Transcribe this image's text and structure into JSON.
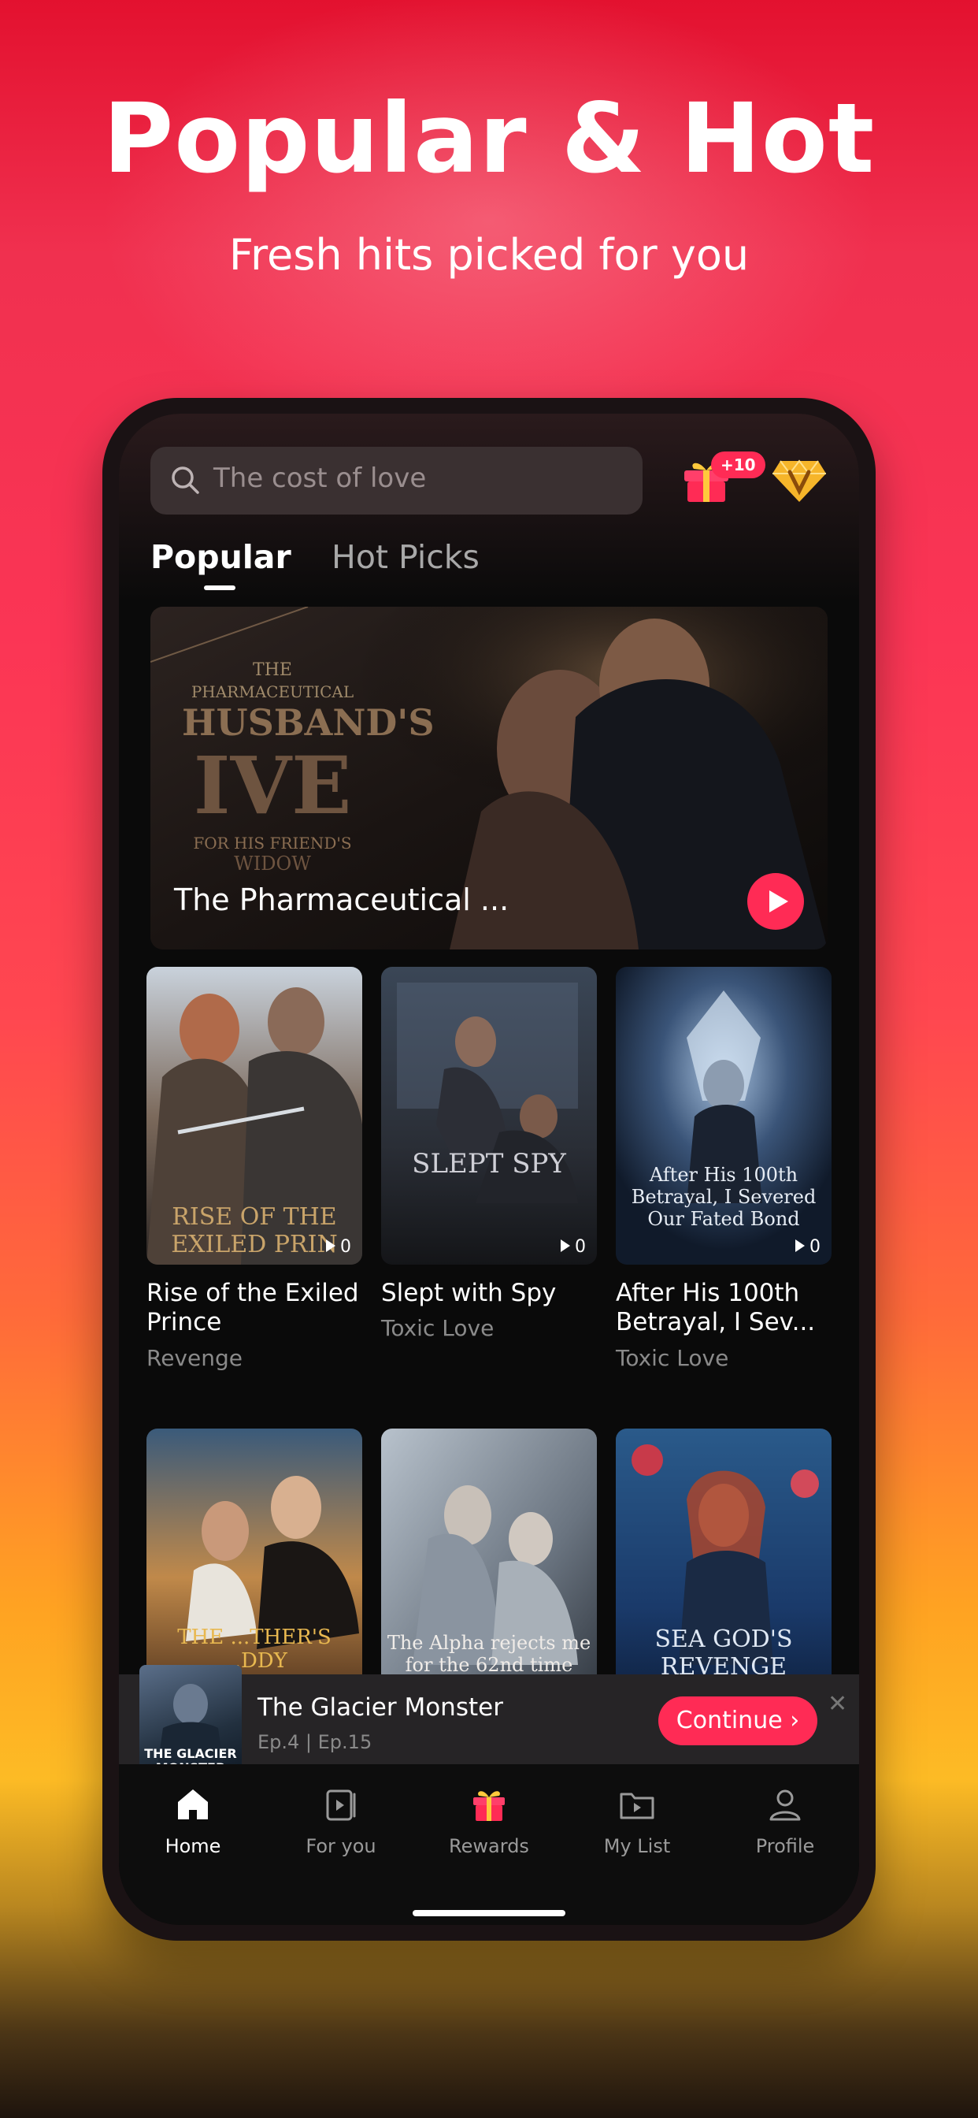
{
  "hero": {
    "title": "Popular & Hot",
    "subtitle": "Fresh hits picked for you"
  },
  "header": {
    "search_placeholder": "The cost of love",
    "gift_badge": "+10",
    "icons": [
      "search-icon",
      "gift-icon",
      "vip-gem-icon"
    ]
  },
  "tabs": [
    {
      "label": "Popular",
      "active": true
    },
    {
      "label": "Hot Picks",
      "active": false
    }
  ],
  "banner": {
    "title": "The Pharmaceutical ...",
    "cover_text": {
      "line1": "THE",
      "line2": "PHARMACEUTICAL",
      "line3": "HUSBAND'S",
      "line4": "IVE",
      "line5": "FOR HIS FRIEND'S",
      "line6": "WIDOW"
    }
  },
  "grid": [
    {
      "title": "Rise of the Exiled Prince",
      "genre": "Revenge",
      "views": "0",
      "cover_text": "RISE OF THE EXILED PRIN"
    },
    {
      "title": "Slept with Spy",
      "genre": "Toxic Love",
      "views": "0",
      "cover_text": "SLEPT SPY"
    },
    {
      "title": "After His 100th Betrayal, I Sev...",
      "genre": "Toxic Love",
      "views": "0",
      "cover_text": "After His 100th Betrayal, I Severed Our Fated Bond"
    },
    {
      "title": "",
      "genre": "",
      "views": "",
      "cover_text": "THE ...THER'S ...DDY"
    },
    {
      "title": "",
      "genre": "",
      "views": "",
      "cover_text": "The Alpha rejects me for the 62nd time"
    },
    {
      "title": "",
      "genre": "",
      "views": "",
      "cover_text": "SEA GOD'S REVENGE"
    }
  ],
  "continue": {
    "title": "The Glacier Monster",
    "episodes": "Ep.4 | Ep.15",
    "button": "Continue",
    "cover_text": "THE GLACIER MONSTER"
  },
  "nav": [
    {
      "label": "Home",
      "icon": "home-icon",
      "active": true
    },
    {
      "label": "For you",
      "icon": "for-you-icon",
      "active": false
    },
    {
      "label": "Rewards",
      "icon": "rewards-gift-icon",
      "active": false
    },
    {
      "label": "My List",
      "icon": "my-list-icon",
      "active": false
    },
    {
      "label": "Profile",
      "icon": "profile-icon",
      "active": false
    }
  ],
  "colors": {
    "accent": "#ff2b55",
    "screen_bg": "#0a0a0a"
  }
}
